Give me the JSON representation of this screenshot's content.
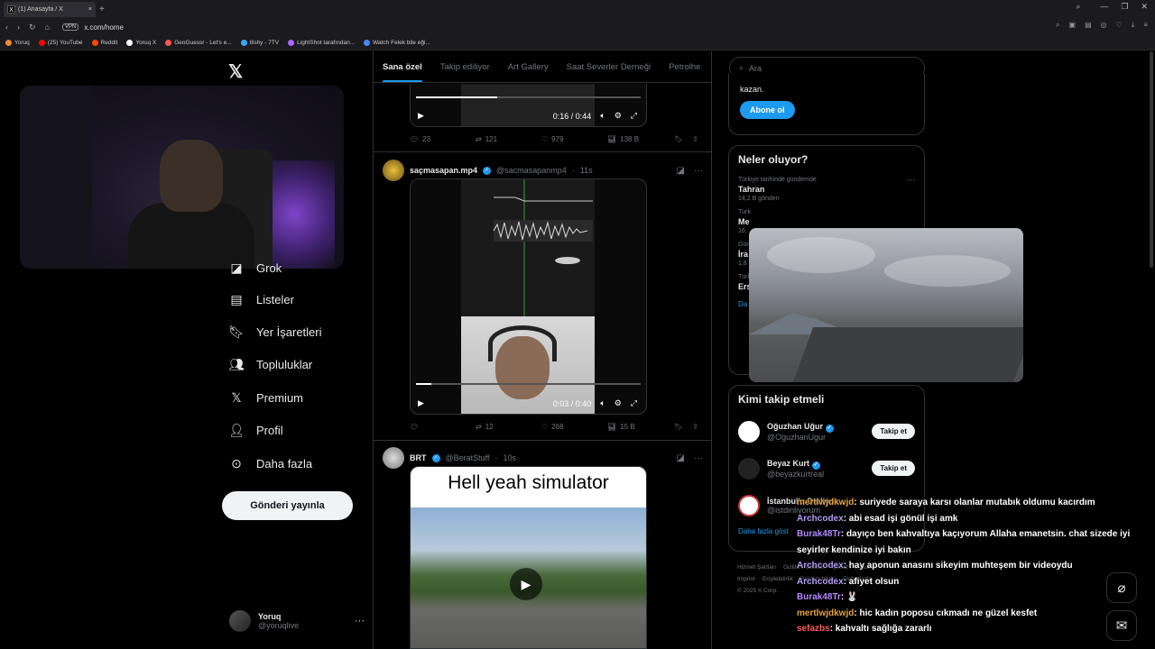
{
  "browser": {
    "tab_title": "(1) Anasayfa / X",
    "tab_favicon": "X",
    "url": "x.com/home",
    "vpn_label": "VPN",
    "bookmarks": [
      {
        "label": "Yoruq",
        "color": "#e83"
      },
      {
        "label": "(25) YouTube",
        "color": "#f00"
      },
      {
        "label": "Reddit",
        "color": "#ff4500"
      },
      {
        "label": "Yoruq X",
        "color": "#fff"
      },
      {
        "label": "GeoGuessr - Let's e...",
        "color": "#f55"
      },
      {
        "label": "Ilishy - 7TV",
        "color": "#3af"
      },
      {
        "label": "LightShot tarafından...",
        "color": "#a6f"
      },
      {
        "label": "Watch Felek bile eği...",
        "color": "#48f"
      }
    ]
  },
  "nav": {
    "items": [
      {
        "label": "Grok",
        "icon": "grok-icon"
      },
      {
        "label": "Listeler",
        "icon": "list-icon"
      },
      {
        "label": "Yer İşaretleri",
        "icon": "bookmark-icon"
      },
      {
        "label": "Topluluklar",
        "icon": "communities-icon"
      },
      {
        "label": "Premium",
        "icon": "x-premium-icon"
      },
      {
        "label": "Profil",
        "icon": "profile-icon"
      },
      {
        "label": "Daha fazla",
        "icon": "more-circle-icon"
      }
    ],
    "post_button": "Gönderi yayınla",
    "profile": {
      "name": "Yoruq",
      "handle": "@yoruqlive"
    }
  },
  "tabs": [
    "Sana özel",
    "Takip ediliyor",
    "Art Gallery",
    "Saat Severler Derneği",
    "Petrolhe"
  ],
  "tweets": [
    {
      "time_current": "0:16",
      "time_total": "0:44",
      "progress": 0.36,
      "replies": "23",
      "reposts": "121",
      "likes": "979",
      "views": "138 B"
    },
    {
      "name": "saçmasapan.mp4",
      "handle": "@sacmasapanmp4",
      "time": "11s",
      "time_current": "0:03",
      "time_total": "0:40",
      "progress": 0.07,
      "replies": "",
      "reposts": "12",
      "likes": "268",
      "views": "15 B"
    },
    {
      "name": "BRT",
      "handle": "@BeratStuff",
      "time": "10s",
      "video_caption": "Hell yeah simulator"
    }
  ],
  "right": {
    "search_placeholder": "Ara",
    "premium_tail": "kazan.",
    "subscribe_label": "Abone ol",
    "trends_title": "Neler oluyor?",
    "trend": {
      "context": "Türkiye tarihinde gündemde",
      "title": "Tahran",
      "count": "14,2 B gönderi"
    },
    "partial_trends": [
      {
        "ctx": "Türk",
        "title": "Me",
        "count": "16,"
      },
      {
        "ctx": "Gün",
        "title": "İra",
        "count": "1,8"
      },
      {
        "ctx": "Türk",
        "title": "Ers",
        "count": ""
      }
    ],
    "show_more_partial": "Da",
    "follow_title": "Kimi takip etmeli",
    "follows": [
      {
        "name": "Oğuzhan Uğur",
        "handle": "@OguzhanUgur",
        "btn": "Takip et"
      },
      {
        "name": "Beyaz Kurt",
        "handle": "@beyazkurtreal",
        "btn": "Takip et"
      },
      {
        "name": "İstanbul'u Dinliyor...",
        "handle": "@istdinliyorum",
        "btn": ""
      }
    ],
    "show_more": "Daha fazla göst",
    "footer": [
      "Hizmet Şartları",
      "Gizlilik Politikası",
      "Çerez Politikası",
      "Imprint",
      "Erişilebilirlik",
      "Reklam bilgisi",
      "Daha fazla",
      "© 2025 X Corp."
    ]
  },
  "chat": [
    {
      "user": "mertlwjdkwjd",
      "color": "#e6a23c",
      "text": ": suriyede saraya karsı olanlar mutabık oldumu kacırdım"
    },
    {
      "user": "Archcodex",
      "color": "#b49cf0",
      "text": ": abi esad işi gönül işi amk"
    },
    {
      "user": "Burak48Tr",
      "color": "#b388ff",
      "text": ": dayıço ben kahvaltıya kaçıyorum Allaha emanetsin. chat sizede iyi seyirler kendinize iyi bakın"
    },
    {
      "user": "Archcodex",
      "color": "#b49cf0",
      "text": ": hay aponun anasını sikeyim muhteşem bir videoydu"
    },
    {
      "user": "Archcodex",
      "color": "#b49cf0",
      "text": ": afiyet olsun"
    },
    {
      "user": "Burak48Tr",
      "color": "#b388ff",
      "text": ": 🐰"
    },
    {
      "user": "mertlwjdkwjd",
      "color": "#e6a23c",
      "text": ": hic kadın poposu cıkmadı ne güzel kesfet"
    },
    {
      "user": "sefazbs",
      "color": "#ff5b5b",
      "text": ": kahvaltı sağlığa zararlı"
    }
  ],
  "colors": {
    "accent": "#1d9bf0",
    "background": "#000000",
    "border": "#2f3336"
  }
}
